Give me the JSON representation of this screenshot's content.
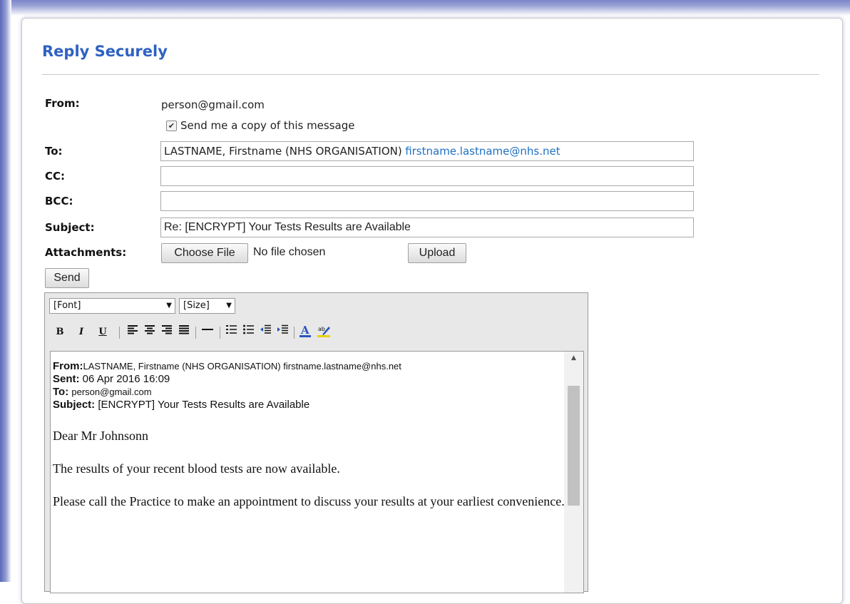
{
  "page": {
    "title": "Reply Securely"
  },
  "form": {
    "from_label": "From:",
    "from_value": "person@gmail.com",
    "copy_checkbox_label": "Send me a copy of this message",
    "copy_checked": true,
    "to_label": "To:",
    "to_name": "LASTNAME, Firstname (NHS ORGANISATION)",
    "to_email": "firstname.lastname@nhs.net",
    "cc_label": "CC:",
    "cc_value": "",
    "bcc_label": "BCC:",
    "bcc_value": "",
    "subject_label": "Subject:",
    "subject_value": "Re: [ENCRYPT] Your Tests Results are Available",
    "attachments_label": "Attachments:",
    "choose_file_label": "Choose File",
    "no_file_text": "No file chosen",
    "upload_label": "Upload",
    "send_label": "Send"
  },
  "editor": {
    "font_select": "[Font]",
    "size_select": "[Size]",
    "toolbar_icons": [
      "bold-icon",
      "italic-icon",
      "underline-icon",
      "align-left-icon",
      "align-center-icon",
      "align-right-icon",
      "justify-icon",
      "horizontal-rule-icon",
      "ordered-list-icon",
      "unordered-list-icon",
      "outdent-icon",
      "indent-icon",
      "font-color-icon",
      "highlight-color-icon"
    ],
    "quoted": {
      "from_label": "From:",
      "from_value": "LASTNAME, Firstname (NHS ORGANISATION) firstname.lastname@nhs.net",
      "sent_label": "Sent:",
      "sent_value": "06 Apr 2016 16:09",
      "to_label": "To:",
      "to_value": "person@gmail.com",
      "subject_label": "Subject:",
      "subject_value": "[ENCRYPT] Your Tests Results are Available"
    },
    "greeting": "Dear Mr Johnsonn",
    "paragraph1": "The results of your recent blood tests are now available.",
    "paragraph2": "Please call the Practice to make an appointment to discuss your results at your earliest convenience."
  },
  "colors": {
    "title": "#2f62c2",
    "link": "#1f70c1",
    "frame": "#7b86c8"
  }
}
